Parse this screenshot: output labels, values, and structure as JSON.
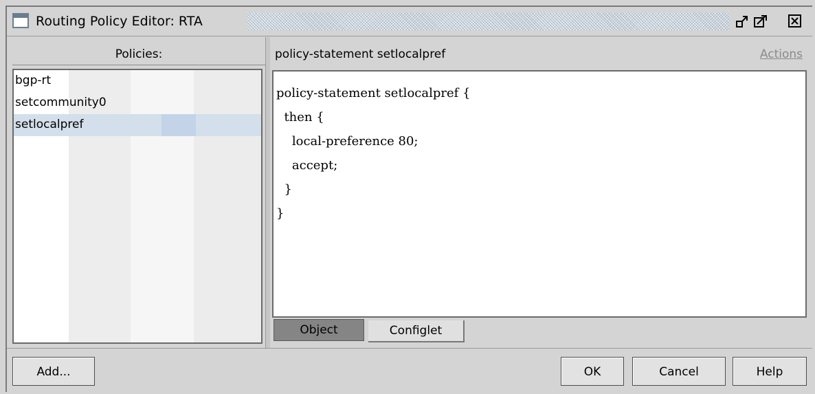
{
  "window": {
    "title": "Routing Policy Editor: RTA",
    "buttons": [
      "minimize-restore",
      "maximize",
      "close"
    ]
  },
  "policies": {
    "header": "Policies:",
    "items": [
      {
        "label": "bgp-rt",
        "selected": false
      },
      {
        "label": "setcommunity0",
        "selected": false
      },
      {
        "label": "setlocalpref",
        "selected": true
      }
    ]
  },
  "editor": {
    "header_title": "policy-statement setlocalpref",
    "actions_label": "Actions",
    "code_lines": [
      "policy-statement setlocalpref {",
      "  then {",
      "    local-preference 80;",
      "    accept;",
      "  }",
      "}"
    ]
  },
  "tabs": [
    {
      "label": "Object",
      "active": true
    },
    {
      "label": "Configlet",
      "active": false
    }
  ],
  "footer": {
    "add_label": "Add...",
    "ok_label": "OK",
    "cancel_label": "Cancel",
    "help_label": "Help"
  }
}
